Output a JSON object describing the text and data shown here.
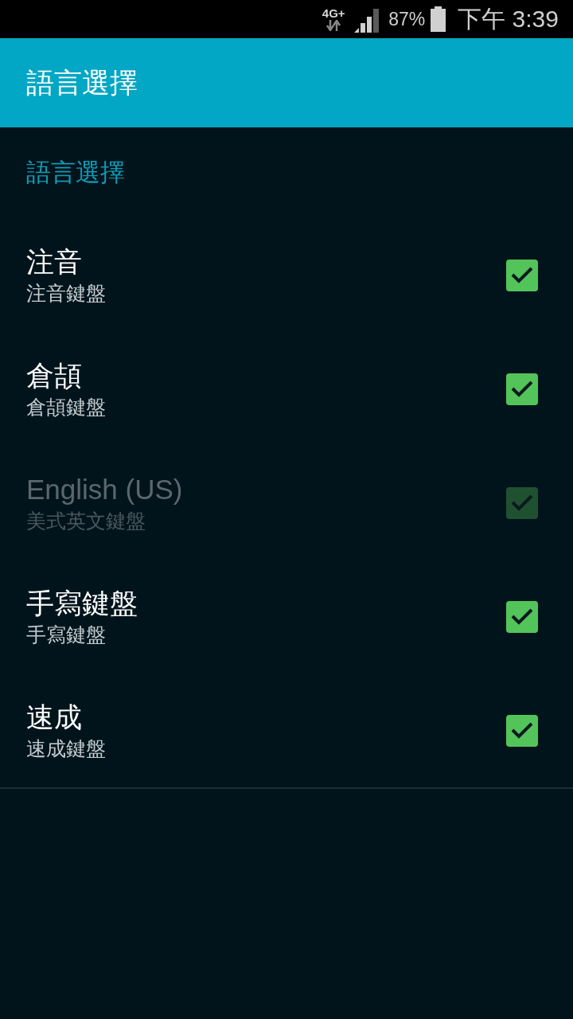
{
  "status_bar": {
    "network": "4G+",
    "battery": "87%",
    "time": "下午 3:39"
  },
  "app_bar": {
    "title": "語言選擇"
  },
  "category": {
    "title": "語言選擇"
  },
  "languages": [
    {
      "title": "注音",
      "summary": "注音鍵盤",
      "checked": true,
      "disabled": false
    },
    {
      "title": "倉頡",
      "summary": "倉頡鍵盤",
      "checked": true,
      "disabled": false
    },
    {
      "title": "English (US)",
      "summary": "美式英文鍵盤",
      "checked": true,
      "disabled": true
    },
    {
      "title": "手寫鍵盤",
      "summary": "手寫鍵盤",
      "checked": true,
      "disabled": false
    },
    {
      "title": "速成",
      "summary": "速成鍵盤",
      "checked": true,
      "disabled": false
    }
  ]
}
